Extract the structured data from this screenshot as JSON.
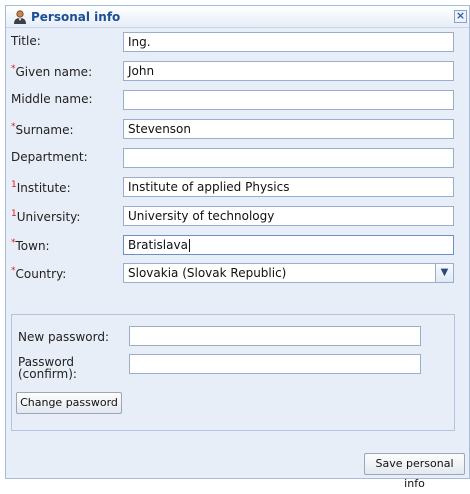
{
  "header": {
    "title": "Personal info",
    "icon": "user-icon",
    "close_glyph": "×"
  },
  "fields": {
    "title": {
      "label": "Title:",
      "value": "Ing.",
      "required": false
    },
    "given_name": {
      "label": "Given name:",
      "value": "John",
      "required": true,
      "marker": "*"
    },
    "middle_name": {
      "label": "Middle name:",
      "value": "",
      "required": false
    },
    "surname": {
      "label": "Surname:",
      "value": "Stevenson",
      "required": true,
      "marker": "*"
    },
    "department": {
      "label": "Department:",
      "value": "",
      "required": false
    },
    "institute": {
      "label": "Institute:",
      "value": "Institute of applied Physics",
      "required": true,
      "marker": "1"
    },
    "university": {
      "label": "University:",
      "value": "University of technology",
      "required": true,
      "marker": "1"
    },
    "town": {
      "label": "Town:",
      "value": "Bratislava",
      "required": true,
      "marker": "*"
    },
    "country": {
      "label": "Country:",
      "value": "Slovakia (Slovak Republic)",
      "required": true,
      "marker": "*"
    }
  },
  "password": {
    "new_label": "New password:",
    "confirm_label": "Password (confirm):",
    "change_button": "Change password"
  },
  "save_button": "Save personal info",
  "colors": {
    "accent": "#1a4f95",
    "required": "#d91c1c",
    "panel_bg": "#e8eef7"
  }
}
